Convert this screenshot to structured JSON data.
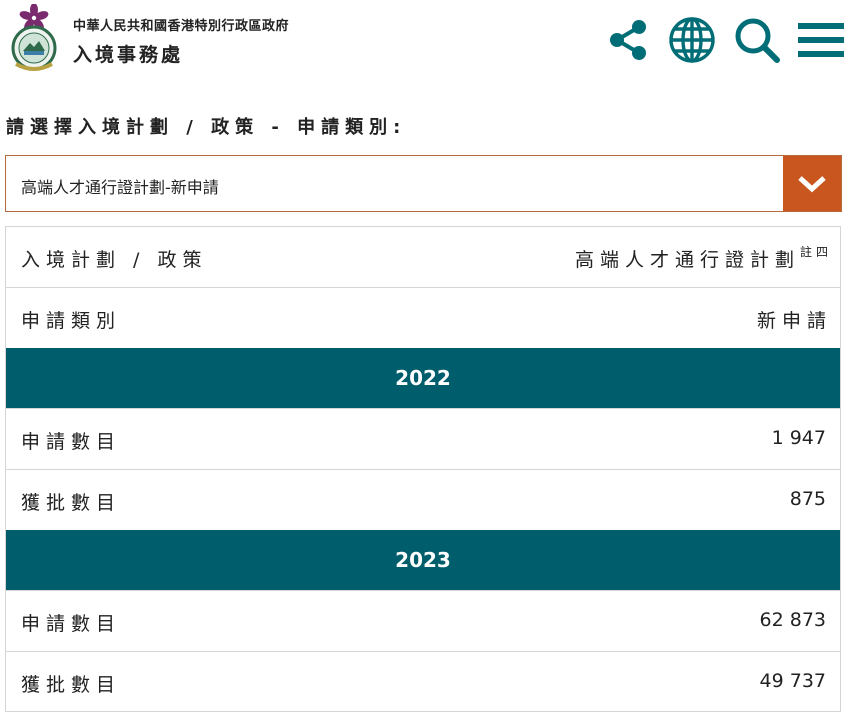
{
  "header": {
    "gov_name": "中華人民共和國香港特別行政區政府",
    "dept_name": "入境事務處",
    "icons": [
      "share-icon",
      "globe-icon",
      "search-icon",
      "menu-icon"
    ],
    "icon_color": "#006d77",
    "emblem_color": "#7a2b6e"
  },
  "selector": {
    "label": "請選擇入境計劃 / 政策 - 申請類別:",
    "selected": "高端人才通行證計劃-新申請",
    "accent": "#c8561e"
  },
  "table": {
    "scheme_label": "入境計劃 / 政策",
    "scheme_value": "高端人才通行證計劃",
    "scheme_note": "註四",
    "category_label": "申請類別",
    "category_value": "新申請",
    "header_color": "#005d6b",
    "years": [
      {
        "year": "2022",
        "rows": [
          {
            "label": "申請數目",
            "value": "1 947"
          },
          {
            "label": "獲批數目",
            "value": "875"
          }
        ]
      },
      {
        "year": "2023",
        "rows": [
          {
            "label": "申請數目",
            "value": "62 873"
          },
          {
            "label": "獲批數目",
            "value": "49 737"
          }
        ]
      }
    ]
  }
}
